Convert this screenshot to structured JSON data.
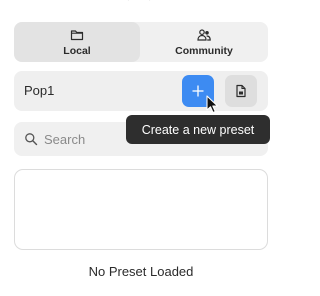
{
  "tabs": [
    {
      "label": "Local",
      "icon": "folder-icon",
      "active": true
    },
    {
      "label": "Community",
      "icon": "users-icon",
      "active": false
    }
  ],
  "preset": {
    "name": "Pop1",
    "add_icon": "plus-icon",
    "save_icon": "file-icon"
  },
  "search": {
    "placeholder": "Search",
    "value": ""
  },
  "tooltip": "Create a new preset",
  "status": "No Preset Loaded",
  "colors": {
    "accent": "#3d8bf2",
    "tooltip_bg": "#2e2e2e",
    "active_tab_bg": "#e3e3e3"
  }
}
